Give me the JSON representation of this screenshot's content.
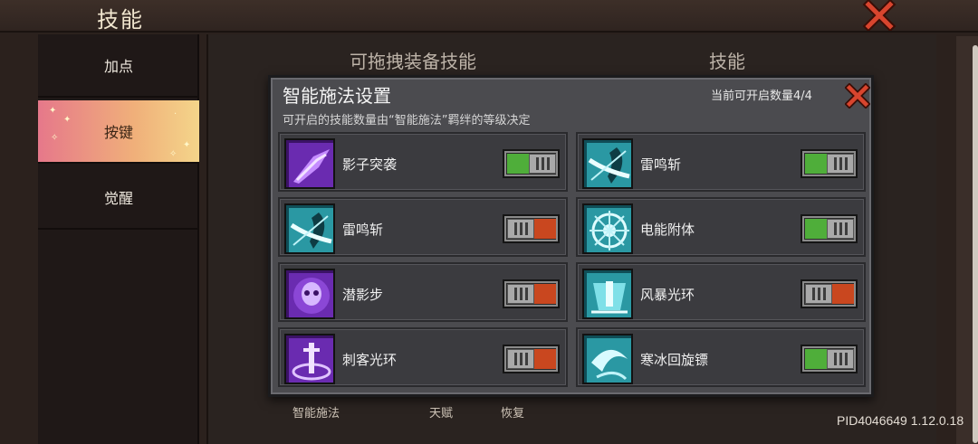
{
  "header": {
    "title": "技能",
    "close_icon": "close-icon",
    "close_color": "#d8452e"
  },
  "sidebar": {
    "items": [
      {
        "label": "加点",
        "active": false
      },
      {
        "label": "按键",
        "active": true
      },
      {
        "label": "觉醒",
        "active": false
      }
    ]
  },
  "main": {
    "col_left": "可拖拽装备技能",
    "col_right": "技能",
    "bottom_labels": [
      "智能施法",
      "天赋",
      "恢复"
    ]
  },
  "version": "PID4046649 1.12.0.18",
  "modal": {
    "title": "智能施法设置",
    "subtitle": "可开启的技能数量由“智能施法”羁绊的等级决定",
    "count": "当前可开启数量4/4",
    "close_icon": "close-icon",
    "skills": [
      {
        "name": "影子突袭",
        "enabled": true,
        "icon": "shadow-strike-icon",
        "theme": "purple"
      },
      {
        "name": "雷鸣斩",
        "enabled": true,
        "icon": "thunder-slash-icon",
        "theme": "cyan"
      },
      {
        "name": "雷鸣斩",
        "enabled": false,
        "icon": "thunder-slash-icon",
        "theme": "cyan"
      },
      {
        "name": "电能附体",
        "enabled": true,
        "icon": "electric-possession-icon",
        "theme": "cyan"
      },
      {
        "name": "潜影步",
        "enabled": false,
        "icon": "shadow-step-icon",
        "theme": "purple"
      },
      {
        "name": "风暴光环",
        "enabled": false,
        "icon": "storm-aura-icon",
        "theme": "cyan"
      },
      {
        "name": "刺客光环",
        "enabled": false,
        "icon": "assassin-aura-icon",
        "theme": "purple"
      },
      {
        "name": "寒冰回旋镖",
        "enabled": true,
        "icon": "ice-boomerang-icon",
        "theme": "cyan"
      }
    ],
    "colors": {
      "on": "#4fae3a",
      "off": "#c9471f"
    }
  }
}
